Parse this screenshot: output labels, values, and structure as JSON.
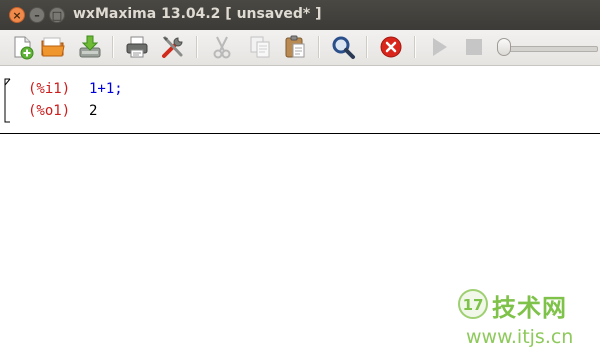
{
  "window": {
    "title": "wxMaxima 13.04.2 [ unsaved* ]",
    "close_glyph": "×",
    "minimize_glyph": "–",
    "maximize_glyph": "□"
  },
  "toolbar": {
    "items": [
      {
        "name": "new-document",
        "icon": "new-file-icon"
      },
      {
        "name": "open",
        "icon": "folder-open-icon"
      },
      {
        "name": "save",
        "icon": "save-download-icon"
      },
      {
        "name": "print",
        "icon": "printer-icon"
      },
      {
        "name": "configure",
        "icon": "tools-icon"
      },
      {
        "name": "cut",
        "icon": "scissors-icon",
        "disabled": true
      },
      {
        "name": "copy",
        "icon": "copy-icon",
        "disabled": true
      },
      {
        "name": "paste",
        "icon": "clipboard-icon"
      },
      {
        "name": "find",
        "icon": "magnifier-icon"
      },
      {
        "name": "interrupt",
        "icon": "stop-x-icon"
      },
      {
        "name": "play-animation",
        "icon": "play-icon",
        "disabled": true
      },
      {
        "name": "stop-animation",
        "icon": "stop-square-icon",
        "disabled": true
      }
    ],
    "animation_slider_position": 0
  },
  "document": {
    "cells": [
      {
        "input_label": "(%i1)",
        "input_expression": "1+1;",
        "output_label": "(%o1)",
        "output_value": "2"
      }
    ]
  },
  "watermark": {
    "logo_text": "17",
    "brand_cn": "技术网",
    "url": "www.itjs.cn"
  },
  "colors": {
    "titlebar": "#3c3b37",
    "close_button": "#f08a4b",
    "input_label": "#cc1c1c",
    "input_expression": "#0000dd",
    "output_value": "#000000",
    "watermark_green": "#7fc24a"
  }
}
